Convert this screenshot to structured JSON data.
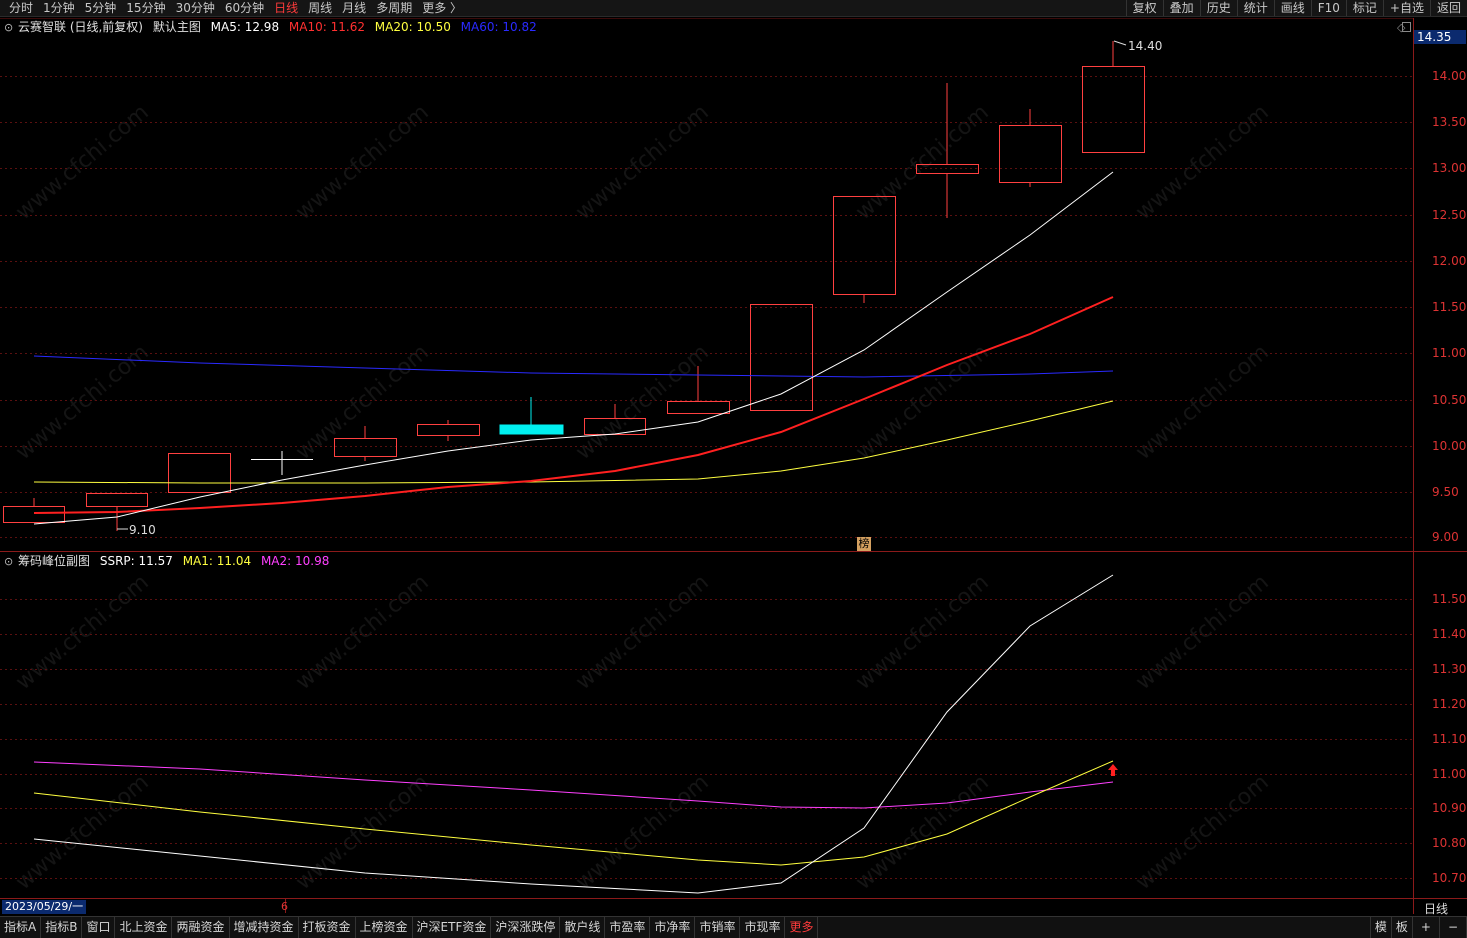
{
  "topbar": {
    "periods": [
      "分时",
      "1分钟",
      "5分钟",
      "15分钟",
      "30分钟",
      "60分钟",
      "日线",
      "周线",
      "月线",
      "多周期",
      "更多 〉"
    ],
    "active": "日线",
    "tools": [
      "复权",
      "叠加",
      "历史",
      "统计",
      "画线",
      "F10",
      "标记",
      "+自选",
      "返回"
    ]
  },
  "main": {
    "title": "云赛智联 (日线,前复权)",
    "chart_name": "默认主图",
    "ma5": "MA5: 12.98",
    "ma10": "MA10: 11.62",
    "ma20": "MA20: 10.50",
    "ma60": "MA60: 10.82",
    "current_price": "14.35",
    "high_label": "14.40",
    "low_label": "9.10",
    "marker": "榜",
    "axis_labels": [
      "14.00",
      "13.50",
      "13.00",
      "12.50",
      "12.00",
      "11.50",
      "11.00",
      "10.50",
      "10.00",
      "9.50",
      "9.00"
    ],
    "colors": {
      "ma5": "#ffffff",
      "ma10": "#ff2020",
      "ma20": "#ffff40",
      "ma60": "#2a2aff",
      "up": "#ff4040",
      "down": "#00ffff"
    }
  },
  "sub": {
    "title": "筹码峰位副图",
    "ssrp": "SSRP: 11.57",
    "ma1": "MA1: 11.04",
    "ma2": "MA2: 10.98",
    "axis_labels": [
      "11.50",
      "11.40",
      "11.30",
      "11.20",
      "11.10",
      "11.00",
      "10.90",
      "10.80",
      "10.70"
    ],
    "colors": {
      "ssrp": "#ffffff",
      "ma1": "#ffff40",
      "ma2": "#ff40ff"
    }
  },
  "footer": {
    "date": "2023/05/29/一",
    "tick": "6",
    "period": "日线",
    "tabs": [
      "指标A",
      "指标B",
      "窗口",
      "北上资金",
      "两融资金",
      "增减持资金",
      "打板资金",
      "上榜资金",
      "沪深ETF资金",
      "沪深涨跌停",
      "散户线",
      "市盈率",
      "市净率",
      "市销率",
      "市现率",
      "更多"
    ],
    "right": [
      "模",
      "板",
      "+",
      "−"
    ]
  },
  "watermark": "www.cfchi.com"
}
